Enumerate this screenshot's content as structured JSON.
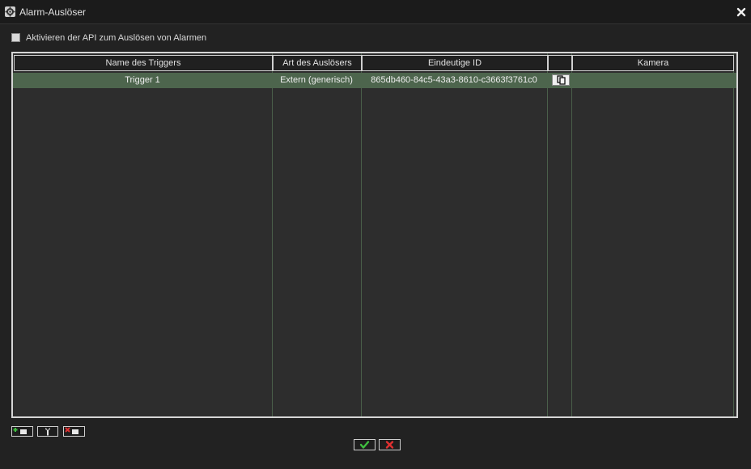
{
  "window": {
    "title": "Alarm-Auslöser",
    "icon": "gear-icon",
    "close_icon": "close-icon"
  },
  "api_toggle": {
    "label": "Aktivieren der API zum Auslösen von Alarmen",
    "checked": false
  },
  "table": {
    "columns": [
      "Name des Triggers",
      "Art des Auslösers",
      "Eindeutige ID",
      "",
      "Kamera"
    ],
    "rows": [
      {
        "name": "Trigger 1",
        "type": "Extern (generisch)",
        "id": "865db460-84c5-43a3-8610-c3663f3761c0",
        "copy_icon": "copy-icon",
        "camera": ""
      }
    ],
    "selected_row_color": "#4d654d",
    "grid_line_color": "#4a5f4a"
  },
  "toolbar": {
    "add_icon": "add-trigger-icon",
    "edit_icon": "wrench-icon",
    "delete_icon": "delete-trigger-icon"
  },
  "footer": {
    "confirm_icon": "checkmark-icon",
    "confirm_color": "#3fbf3f",
    "cancel_icon": "x-icon",
    "cancel_color": "#e03030"
  }
}
